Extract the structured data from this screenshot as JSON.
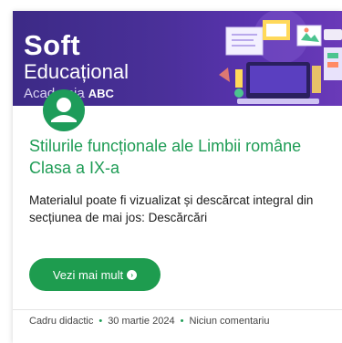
{
  "banner": {
    "brand_line1": "Soft",
    "brand_line2": "Educațional",
    "brand_line3": "Academia",
    "brand_badge": "ABC",
    "background_color": "#4a3099"
  },
  "post": {
    "author_avatar_icon": "user-avatar-icon",
    "title": "Stilurile funcționale ale Limbii române Clasa a IX-a",
    "excerpt": "Materialul poate fi vizualizat și descărcat integral din secțiunea de mai jos: Descărcări",
    "read_more_label": "Vezi mai mult",
    "read_more_icon": "chevron-right-circle-icon",
    "accent_color": "#1e9c55"
  },
  "meta": {
    "author": "Cadru didactic",
    "separator": "•",
    "date": "30 martie 2024",
    "comments": "Niciun comentariu"
  }
}
